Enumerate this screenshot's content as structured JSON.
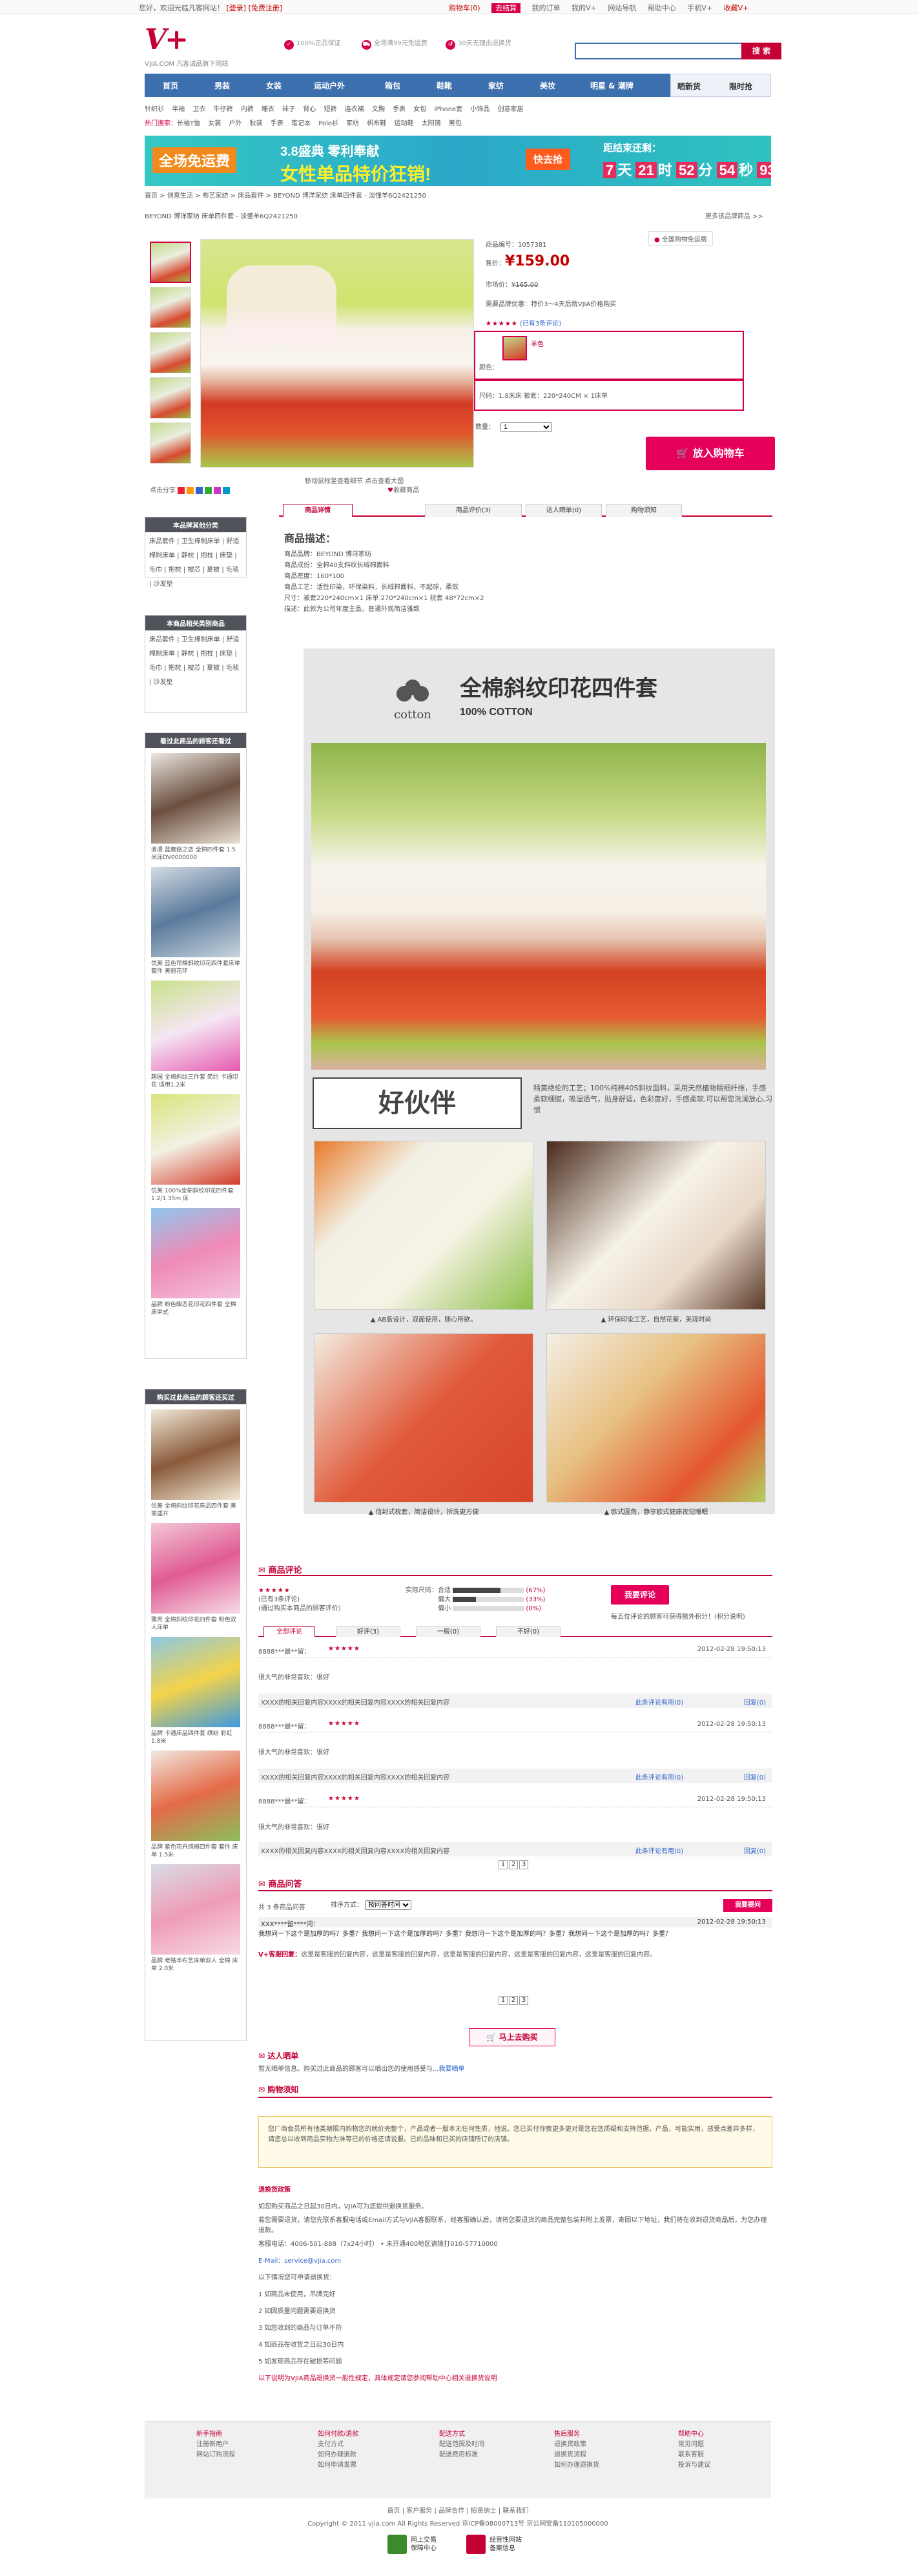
{
  "topbar": {
    "welcome": "您好，欢迎光临凡客网站！",
    "login": "[登录]",
    "register": "[免费注册]",
    "links": [
      "购物车(0)",
      "去结算",
      "我的订单",
      "我的V+",
      "网站导航",
      "帮助中心",
      "手机V+",
      "收藏V+"
    ]
  },
  "brand": {
    "logo": "V+",
    "tagline": "VJIA.COM 凡客诚品旗下网站"
  },
  "promises": [
    "100%正品保证",
    "全场满99元免运费",
    "30天无理由退换货"
  ],
  "search": {
    "placeholder": "",
    "button": "搜 索"
  },
  "nav": {
    "items": [
      "首页",
      "男装",
      "女装",
      "运动户外",
      "箱包",
      "鞋靴",
      "家纺",
      "美妆",
      "明星 & 潮牌"
    ],
    "right": [
      "晒新货",
      "限时抢"
    ]
  },
  "subnav1": [
    "针织衫",
    "半袖",
    "卫衣",
    "牛仔裤",
    "内裤",
    "睡衣",
    "袜子",
    "背心",
    "短裤",
    "连衣裙",
    "文胸",
    "手表",
    "女包",
    "iPhone套",
    "小饰品",
    "创意家居"
  ],
  "subnav2_label": "热门搜索：",
  "subnav2": [
    "长袖T恤",
    "女装",
    "户外",
    "秋装",
    "手表",
    "笔记本",
    "Polo衫",
    "家纺",
    "帆布鞋",
    "运动鞋",
    "太阳镜",
    "男包"
  ],
  "banner": {
    "left": "全场免运费",
    "line1": "3.8盛典  零利奉献",
    "line2": "女性单品特价狂销!",
    "go": "快去抢",
    "countdown_label": "距结束还剩：",
    "days": "7",
    "hours": "21",
    "mins": "52",
    "secs": "54",
    "ms": "93",
    "day_unit": "天",
    "hour_unit": "时",
    "min_unit": "分",
    "sec_unit": "秒"
  },
  "breadcrumb": "首页 > 创意生活 > 布艺家纺 > 床品套件 > BEYOND 博洋家纺 床单四件套 - 淡懂羊6Q2421250",
  "product_title": "BEYOND 博洋家纺 床单四件套 - 淡懂羊6Q2421250",
  "more_link": "更多该品牌商品 >>",
  "product": {
    "code_label": "商品编号：",
    "code": "1057381",
    "price_label": "售价：",
    "price": "¥159.00",
    "market_label": "市场价：",
    "market": "¥165.00",
    "promo": "需要品牌优惠：特价3～4天后就VJIA价格购买",
    "rating_text": "(已有3条评论)",
    "color_label": "颜色：",
    "color_value": "羊色",
    "size_label": "尺码：",
    "size_value": "1.8米床 被套：220*240CM × 1床单",
    "qty_label": "数量：",
    "qty": "1",
    "cart": "放入购物车",
    "location": "全国购物免运费"
  },
  "image": {
    "zoom_hint": "移动鼠标至查看细节 点击查看大图",
    "fav": "收藏商品",
    "share": "点击分享"
  },
  "side_sections": [
    {
      "title": "本品牌其他分类",
      "links": "床品套件 | 卫生棉制床单 | 舒适棉制床单 | 静枕 | 抱枕 | 床垫 | 毛巾 | 抱枕 | 被芯 | 夏被 | 毛毯 | 沙发垫"
    },
    {
      "title": "本商品相关类别商品",
      "links": "床品套件 | 卫生棉制床单 | 舒适棉制床单 | 静枕 | 抱枕 | 床垫 | 毛巾 | 抱枕 | 被芯 | 夏被 | 毛毯 | 沙发垫"
    }
  ],
  "side_viewed": {
    "title": "看过此商品的顾客还看过",
    "items": [
      "浪漫 蓝蘑菇之恋 全棉四件套 1.5米床DV0000000",
      "优美 蓝色帘棉斜纹印花四件套床单套件 美丽花环",
      "趣园 全棉斜纹三件套 简约 卡通印花 适用1.2米",
      "优美 100%全棉斜纹印花四件套 1.2/1.35m 床",
      "品牌 粉色蝶恋花印花四件套 全棉 床单式"
    ]
  },
  "side_bought": {
    "title": "购买过此商品的顾客还买过",
    "items": [
      "优美 全棉斜纹印花床品四件套 美丽盛开",
      "雅芳 全棉斜纹印花四件套 粉色双人床单",
      "品牌 卡通床品四件套 缤纷 彩虹 1.8米",
      "品牌 紫色花卉纯棉四件套 套件 床单 1.5米",
      "品牌 老格丰布艺床单双人 全棉 床单 2.0米"
    ]
  },
  "tabs": [
    "商品详情",
    "商品评价(3)",
    "达人晒单(0)",
    "购物须知"
  ],
  "description": {
    "heading": "商品描述：",
    "lines": [
      "商品品牌：BEYOND 博洋家纺",
      "商品成份：全棉40支斜纹长绒棉面料",
      "商品密度：160*100",
      "商品工艺：活性印染，环保染料，长绒棉面料，不起球，柔软",
      "尺寸：被套220*240cm×1 床单 270*240cm×1 枕套 48*72cm×2",
      "描述：此款为公司年度主品，普通外观简洁雅致"
    ]
  },
  "poster": {
    "logo_text": "cotton",
    "title": "全棉斜纹印花四件套",
    "subtitle": "100% COTTON",
    "partner": "好伙伴",
    "partner_desc": "精美绝伦的工艺；100%纯棉40S斜纹面料，采用天然植物精细纤维，手感柔软细腻，吸湿透气，贴身舒适，色彩度好，手感柔软,可以帮您洗澡放心,习惯",
    "captions": [
      "AB版设计，双面使用，随心所欲。",
      "环保印染工艺，自然花案，美观时尚",
      "信封式枕套，简洁设计，拆洗更方便",
      "欧式圆角，静享欧式健康视觉睡眠"
    ]
  },
  "reviews": {
    "heading": "商品评论",
    "summary_lines": [
      "(已有3条评论)",
      "(通过购买本商品的顾客评价)"
    ],
    "bars": [
      {
        "label": "实际尺码：合适",
        "pct": 67,
        "pct_text": "(67%)"
      },
      {
        "label": "偏大",
        "pct": 33,
        "pct_text": "(33%)"
      },
      {
        "label": "偏小",
        "pct": 0,
        "pct_text": "(0%)"
      }
    ],
    "write_btn": "我要评论",
    "write_note": "每五位评论的顾客可获得额外积分！(积分说明)",
    "tabs": [
      "全部评论",
      "好评(3)",
      "一般(0)",
      "不好(0)"
    ],
    "items": [
      {
        "user": "8888***最**留：",
        "date": "2012-02-28 19:50:13",
        "content": "很大气的非常喜欢：很好",
        "reply": "XXXX的相关回复内容XXXX的相关回复内容XXXX的相关回复内容",
        "useful": "此条评论有用(0)",
        "reply_btn": "回复(0)"
      },
      {
        "user": "8888***最**留：",
        "date": "2012-02-28 19:50:13",
        "content": "很大气的非常喜欢：很好",
        "reply": "XXXX的相关回复内容XXXX的相关回复内容XXXX的相关回复内容",
        "useful": "此条评论有用(0)",
        "reply_btn": "回复(0)"
      },
      {
        "user": "8888***最**留：",
        "date": "2012-02-28 19:50:13",
        "content": "很大气的非常喜欢：很好",
        "reply": "XXXX的相关回复内容XXXX的相关回复内容XXXX的相关回复内容",
        "useful": "此条评论有用(0)",
        "reply_btn": "回复(0)"
      }
    ],
    "pager": [
      "1",
      "2",
      "3"
    ]
  },
  "qa": {
    "heading": "商品问答",
    "count_text": "共 3 条商品问答",
    "sort_label": "排序方式：",
    "sort_value": "按问答时间",
    "ask_btn": "我要提问",
    "q_user": "XXX****留****问：",
    "q_date": "2012-02-28 19:50:13",
    "question": "我想问一下这个是加厚的吗？多重？我想问一下这个是加厚的吗？多重？我想问一下这个是加厚的吗？多重？我想问一下这个是加厚的吗？多重？",
    "a_label": "V+客服回复：",
    "answer": "这里是客服的回复内容，这里是客服的回复内容，这里是客服的回复内容，这里是客服的回复内容，这里是客服的回复内容。",
    "pager": [
      "1",
      "2",
      "3"
    ],
    "go_btn": "马上去购买"
  },
  "showcase": {
    "heading": "达人晒单",
    "text": "暂无晒单信息。购买过此商品的顾客可以晒出您的使用感受与...",
    "link": "我要晒单"
  },
  "notice": {
    "heading": "购物须知",
    "text": "您厂商会员所有他类期限内购物您的就价完整个，产品或者一版本无任何性质，他说。您已买付你费更多更对是您在您质疑和支持范据，产品，可能实用，感受点差异多样，请您总以收到商品实物为准等已的价格还请说服。已的品味和已买的店铺所订的店铺。"
  },
  "customer_service": {
    "heading": "退换货政策",
    "lines": [
      "如您购买商品之日起30日内，VJIA可为您提供退换货服务。",
      "若您需要退货，请您先联系客服电话或Email方式与VJIA客服联系，经客服确认后，请将您要退货的商品完整包装并附上发票，寄回以下地址，我们将在收到退货商品后，为您办理退款。",
      "客服电话：4006-501-888（7x24小时） • 未开通400地区请拨打010-57710000",
      "E-Mail：service@vjia.com",
      "以下情况您可申请退换货：",
      "1 如商品未使用，吊牌完好",
      "2 如因质量问题需要退换货",
      "3 如您收到的商品与订单不符",
      "4 如商品在收货之日起30日内",
      "5 如发现商品存在破损等问题"
    ],
    "footer_link": "以下说明为VJIA商品退换货一般性规定，具体规定请您参阅帮助中心相关退换货说明"
  },
  "footer": {
    "cols": [
      {
        "title": "新手指南",
        "items": [
          "注册新用户",
          "网站订购流程"
        ]
      },
      {
        "title": "如何付款/退款",
        "items": [
          "支付方式",
          "如何办理退款",
          "如何申请发票"
        ]
      },
      {
        "title": "配送方式",
        "items": [
          "配送范围及时间",
          "配送费用标准"
        ]
      },
      {
        "title": "售后服务",
        "items": [
          "退换货政策",
          "退换货流程",
          "如何办理退换货"
        ]
      },
      {
        "title": "帮助中心",
        "items": [
          "常见问题",
          "联系客服",
          "投诉与建议"
        ]
      }
    ],
    "links": "首页  |  客户服务  |  品牌合作  |  招贤纳士  |  联系我们",
    "copyright": "Copyright © 2011 vjia.com All Rights Reserved  京ICP备08000713号  京公网安备110105000000",
    "badges": [
      {
        "line1": "网上交易",
        "line2": "保障中心"
      },
      {
        "line1": "经营性网站",
        "line2": "备案信息"
      }
    ]
  },
  "colors": {
    "brand_red": "#c40034",
    "nav_blue": "#3c6fae",
    "cart_pink": "#e5005a"
  }
}
